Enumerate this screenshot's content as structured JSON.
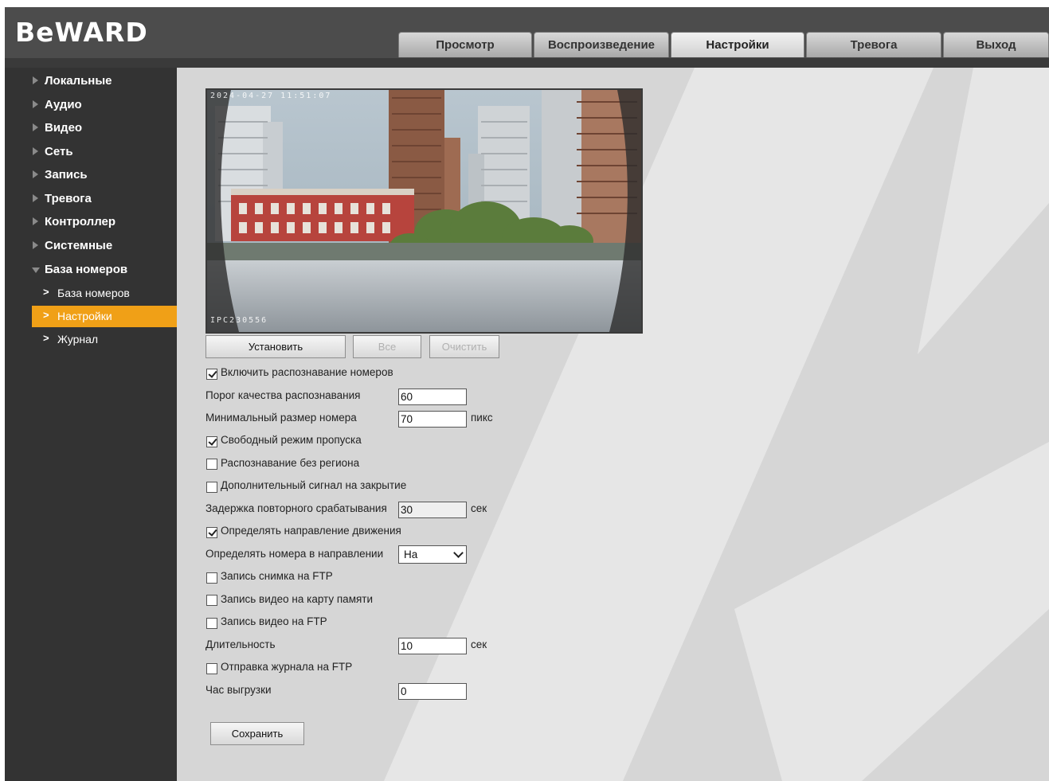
{
  "logo": "BeWARD",
  "tabs": [
    {
      "label": "Просмотр"
    },
    {
      "label": "Воспроизведение"
    },
    {
      "label": "Настройки"
    },
    {
      "label": "Тревога"
    },
    {
      "label": "Выход"
    }
  ],
  "active_tab": "Настройки",
  "sidebar": {
    "items": [
      {
        "label": "Локальные"
      },
      {
        "label": "Аудио"
      },
      {
        "label": "Видео"
      },
      {
        "label": "Сеть"
      },
      {
        "label": "Запись"
      },
      {
        "label": "Тревога"
      },
      {
        "label": "Контроллер"
      },
      {
        "label": "Системные"
      },
      {
        "label": "База номеров"
      }
    ],
    "subitems": [
      {
        "label": "База номеров"
      },
      {
        "label": "Настройки"
      },
      {
        "label": "Журнал"
      }
    ],
    "active_subitem": "Настройки"
  },
  "video": {
    "osd_time": "2024-04-27 11:51:07",
    "osd_name": "IPC230556"
  },
  "buttons": {
    "set": "Установить",
    "all": "Все",
    "clear": "Очистить",
    "save": "Сохранить"
  },
  "form": {
    "enable_recognition": {
      "label": "Включить распознавание номеров",
      "checked": true
    },
    "quality_threshold": {
      "label": "Порог качества распознавания",
      "value": "60"
    },
    "min_plate_size": {
      "label": "Минимальный размер номера",
      "value": "70",
      "unit": "пикс"
    },
    "free_pass_mode": {
      "label": "Свободный режим пропуска",
      "checked": true
    },
    "recognition_no_region": {
      "label": "Распознавание без региона",
      "checked": false
    },
    "extra_close_signal": {
      "label": "Дополнительный сигнал на закрытие",
      "checked": false
    },
    "retrigger_delay": {
      "label": "Задержка повторного срабатывания",
      "value": "30",
      "unit": "сек"
    },
    "detect_direction": {
      "label": "Определять направление движения",
      "checked": true
    },
    "direction_select": {
      "label": "Определять номера в направлении",
      "value": "На"
    },
    "ftp_snapshot": {
      "label": "Запись снимка на FTP",
      "checked": false
    },
    "sd_video": {
      "label": "Запись видео на карту памяти",
      "checked": false
    },
    "ftp_video": {
      "label": "Запись видео на FTP",
      "checked": false
    },
    "duration": {
      "label": "Длительность",
      "value": "10",
      "unit": "сек"
    },
    "ftp_journal": {
      "label": "Отправка журнала на FTP",
      "checked": false
    },
    "upload_hour": {
      "label": "Час выгрузки",
      "value": "0"
    }
  },
  "colors": {
    "header_bg": "#4c4c4c",
    "sidebar_bg": "#333333",
    "content_bg": "#d6d6d6",
    "active_orange": "#f0a017"
  }
}
